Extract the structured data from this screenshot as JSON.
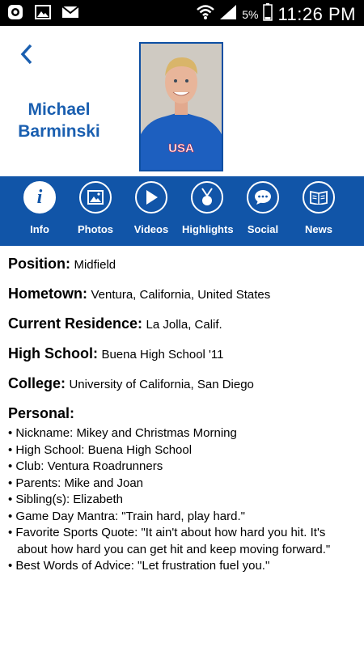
{
  "status_bar": {
    "battery_percent": "5%",
    "time": "11:26 PM",
    "left_icons": [
      "messenger-icon",
      "gallery-icon",
      "mail-icon"
    ],
    "right_icons": [
      "wifi-icon",
      "signal-icon",
      "battery-icon"
    ]
  },
  "player": {
    "first_name": "Michael",
    "last_name": "Barminski",
    "photo_shirt_text": "USA"
  },
  "tabs": [
    {
      "label": "Info",
      "icon": "info-icon",
      "active": true
    },
    {
      "label": "Photos",
      "icon": "photo-icon",
      "active": false
    },
    {
      "label": "Videos",
      "icon": "play-icon",
      "active": false
    },
    {
      "label": "Highlights",
      "icon": "medal-icon",
      "active": false
    },
    {
      "label": "Social",
      "icon": "chat-bubble-icon",
      "active": false
    },
    {
      "label": "News",
      "icon": "newspaper-icon",
      "active": false
    }
  ],
  "info": {
    "position_label": "Position:",
    "position": "Midfield",
    "hometown_label": "Hometown:",
    "hometown": "Ventura, California, United States",
    "residence_label": "Current Residence:",
    "residence": "La Jolla, Calif.",
    "high_school_label": "High School:",
    "high_school": "Buena High School '11",
    "college_label": "College:",
    "college": "University of California, San Diego",
    "personal_label": "Personal:",
    "personal": [
      "• Nickname: Mikey and Christmas Morning",
      "• High School: Buena High School",
      "• Club: Ventura Roadrunners",
      "• Parents: Mike and Joan",
      "• Sibling(s): Elizabeth",
      "• Game Day Mantra: \"Train hard, play hard.\"",
      "• Favorite Sports Quote: \"It ain't about how hard you hit. It's about how hard you can get hit and keep moving forward.\"",
      "• Best Words of Advice: \"Let frustration fuel you.\""
    ]
  },
  "colors": {
    "accent": "#1155a8",
    "name_text": "#1a5fb0",
    "status_bar": "#000000"
  }
}
